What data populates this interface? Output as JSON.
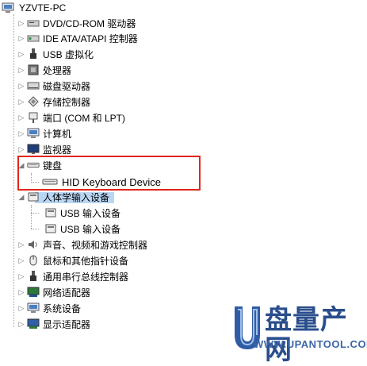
{
  "device_tree": {
    "root": {
      "label": "YZVTE-PC",
      "icon": "computer-icon"
    },
    "items": [
      {
        "label": "DVD/CD-ROM 驱动器",
        "icon": "dvd-drive-icon",
        "expanded": false
      },
      {
        "label": "IDE ATA/ATAPI 控制器",
        "icon": "ide-controller-icon",
        "expanded": false
      },
      {
        "label": "USB 虚拟化",
        "icon": "usb-icon",
        "expanded": false
      },
      {
        "label": "处理器",
        "icon": "processor-icon",
        "expanded": false
      },
      {
        "label": "磁盘驱动器",
        "icon": "disk-drive-icon",
        "expanded": false
      },
      {
        "label": "存储控制器",
        "icon": "storage-controller-icon",
        "expanded": false
      },
      {
        "label": "端口 (COM 和 LPT)",
        "icon": "port-icon",
        "expanded": false
      },
      {
        "label": "计算机",
        "icon": "computer-icon",
        "expanded": false
      },
      {
        "label": "监视器",
        "icon": "monitor-icon",
        "expanded": false
      },
      {
        "label": "键盘",
        "icon": "keyboard-icon",
        "expanded": true,
        "children": [
          {
            "label": "HID Keyboard Device",
            "icon": "keyboard-icon"
          }
        ]
      },
      {
        "label": "人体学输入设备",
        "icon": "hid-icon",
        "expanded": true,
        "children": [
          {
            "label": "USB 输入设备",
            "icon": "hid-icon"
          },
          {
            "label": "USB 输入设备",
            "icon": "hid-icon"
          }
        ]
      },
      {
        "label": "声音、视频和游戏控制器",
        "icon": "speaker-icon",
        "expanded": false
      },
      {
        "label": "鼠标和其他指针设备",
        "icon": "mouse-icon",
        "expanded": false
      },
      {
        "label": "通用串行总线控制器",
        "icon": "usb-icon",
        "expanded": false
      },
      {
        "label": "网络适配器",
        "icon": "network-adapter-icon",
        "expanded": false
      },
      {
        "label": "系统设备",
        "icon": "system-device-icon",
        "expanded": false
      },
      {
        "label": "显示适配器",
        "icon": "display-adapter-icon",
        "expanded": false
      }
    ]
  },
  "highlight_color": "#e0261c",
  "watermark": {
    "brand": "盘量产网",
    "url": "WWW.UPANTOOL.COM"
  }
}
